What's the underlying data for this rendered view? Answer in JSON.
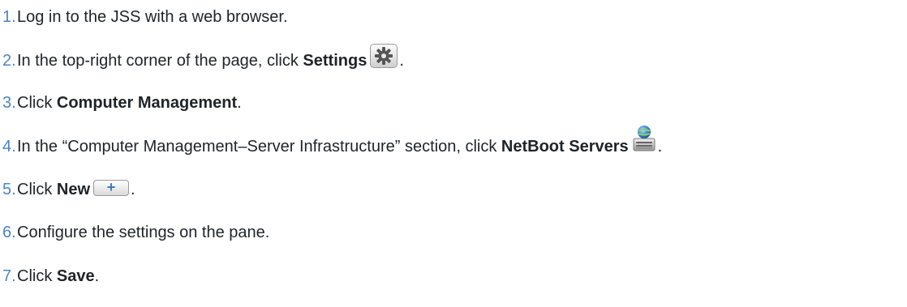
{
  "steps": [
    {
      "number": "1.",
      "text": "Log in to the JSS with a web browser."
    },
    {
      "number": "2.",
      "prefix": "In the top-right corner of the page, click ",
      "bold": "Settings",
      "icon": "gear-icon",
      "suffix": "."
    },
    {
      "number": "3.",
      "prefix": "Click ",
      "bold": "Computer Management",
      "suffix": "."
    },
    {
      "number": "4.",
      "prefix": "In the “Computer Management–Server Infrastructure” section, click ",
      "bold": "NetBoot Servers",
      "icon": "netboot-server-icon",
      "suffix": "."
    },
    {
      "number": "5.",
      "prefix": "Click ",
      "bold": "New",
      "icon": "plus-icon",
      "icon_glyph": "+",
      "suffix": "."
    },
    {
      "number": "6.",
      "text": "Configure the settings on the pane."
    },
    {
      "number": "7.",
      "prefix": "Click ",
      "bold": "Save",
      "suffix": "."
    }
  ],
  "colors": {
    "step_number": "#4a86c5",
    "text": "#1f2328",
    "plus_glyph": "#3a78c3"
  }
}
